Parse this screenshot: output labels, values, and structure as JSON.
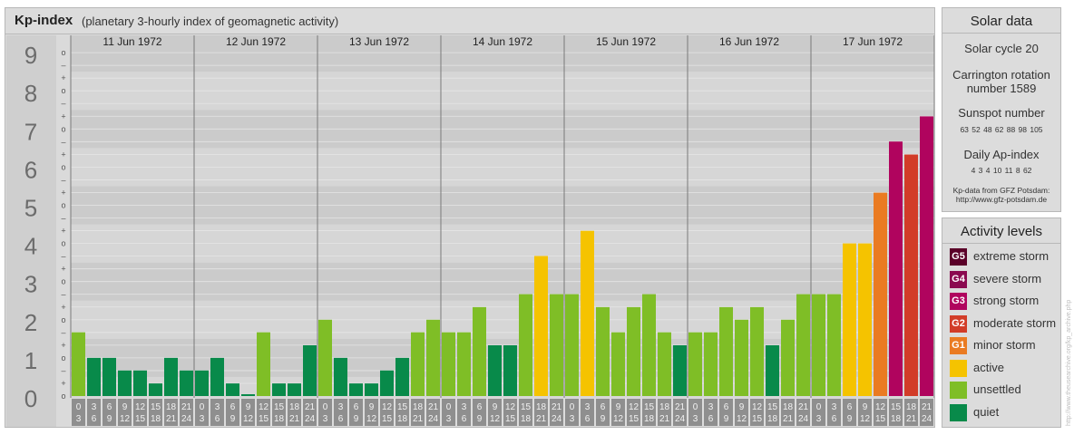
{
  "header": {
    "title": "Kp-index",
    "subtitle": "(planetary 3-hourly index of geomagnetic activity)"
  },
  "solar": {
    "title": "Solar data",
    "cycle": "Solar cycle 20",
    "carrington_line1": "Carrington rotation",
    "carrington_line2": "number 1589",
    "sunspot_title": "Sunspot number",
    "sunspot_values": "63 52 48 62 88 98 105",
    "ap_title": "Daily Ap-index",
    "ap_values": "4 3 4 10 11 8 62",
    "source_line1": "Kp-data from GFZ Potsdam:",
    "source_line2": "http://www.gfz-potsdam.de"
  },
  "activity": {
    "title": "Activity levels",
    "levels": [
      {
        "code": "G5",
        "label": "extreme storm",
        "color": "#5a0028"
      },
      {
        "code": "G4",
        "label": "severe storm",
        "color": "#8b0a50"
      },
      {
        "code": "G3",
        "label": "strong storm",
        "color": "#b0045e"
      },
      {
        "code": "G2",
        "label": "moderate storm",
        "color": "#d23c28"
      },
      {
        "code": "G1",
        "label": "minor storm",
        "color": "#ea7b22"
      },
      {
        "code": "",
        "label": "active",
        "color": "#f5c300"
      },
      {
        "code": "",
        "label": "unsettled",
        "color": "#7fbe26"
      },
      {
        "code": "",
        "label": "quiet",
        "color": "#088a4a"
      }
    ]
  },
  "archive_note": "http://www.theusearchive.org/kp_archive.php",
  "chart_data": {
    "type": "bar",
    "title": "Kp-index",
    "subtitle": "(planetary 3-hourly index of geomagnetic activity)",
    "ylim": [
      0,
      9
    ],
    "y_ticks": [
      "0",
      "1",
      "2",
      "3",
      "4",
      "5",
      "6",
      "7",
      "8",
      "9"
    ],
    "minor_ticks": [
      "o",
      "+",
      "–"
    ],
    "days": [
      "11 Jun 1972",
      "12 Jun 1972",
      "13 Jun 1972",
      "14 Jun 1972",
      "15 Jun 1972",
      "16 Jun 1972",
      "17 Jun 1972"
    ],
    "interval_starts": [
      "0",
      "3",
      "6",
      "9",
      "12",
      "15",
      "18",
      "21"
    ],
    "interval_ends": [
      "3",
      "6",
      "9",
      "12",
      "15",
      "18",
      "21",
      "24"
    ],
    "values": [
      [
        1.67,
        1.0,
        1.0,
        0.67,
        0.67,
        0.33,
        1.0,
        0.67
      ],
      [
        0.67,
        1.0,
        0.33,
        0.0,
        1.67,
        0.33,
        0.33,
        1.33
      ],
      [
        2.0,
        1.0,
        0.33,
        0.33,
        0.67,
        1.0,
        1.67,
        2.0
      ],
      [
        1.67,
        1.67,
        2.33,
        1.33,
        1.33,
        2.67,
        3.67,
        2.67
      ],
      [
        2.67,
        4.33,
        2.33,
        1.67,
        2.33,
        2.67,
        1.67,
        1.33
      ],
      [
        1.67,
        1.67,
        2.33,
        2.0,
        2.33,
        1.33,
        2.0,
        2.67
      ],
      [
        2.67,
        2.67,
        4.0,
        4.0,
        5.33,
        6.67,
        6.33,
        7.33
      ]
    ]
  }
}
